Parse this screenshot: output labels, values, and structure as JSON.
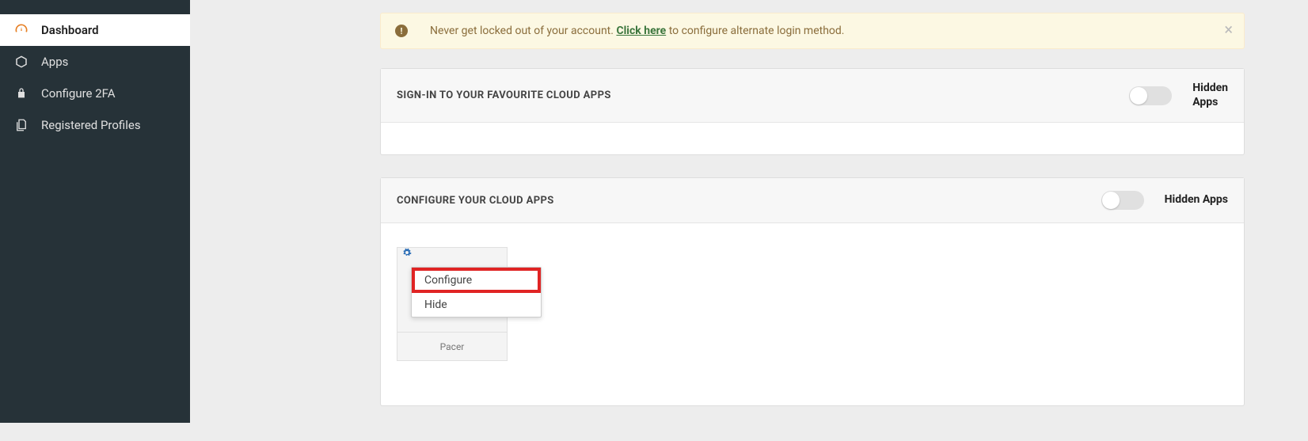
{
  "sidebar": {
    "items": [
      {
        "label": "Dashboard",
        "icon": "gauge-icon",
        "active": true
      },
      {
        "label": "Apps",
        "icon": "cube-icon",
        "active": false
      },
      {
        "label": "Configure 2FA",
        "icon": "lock-icon",
        "active": false
      },
      {
        "label": "Registered Profiles",
        "icon": "files-icon",
        "active": false
      }
    ]
  },
  "alert": {
    "text_before": "Never get locked out of your account. ",
    "link_text": "Click here",
    "text_after": " to configure alternate login method."
  },
  "panel_signin": {
    "title": "SIGN-IN TO YOUR FAVOURITE CLOUD APPS",
    "hidden_label_line1": "Hidden",
    "hidden_label_line2": "Apps"
  },
  "panel_configure": {
    "title": "CONFIGURE YOUR CLOUD APPS",
    "hidden_label": "Hidden Apps",
    "app": {
      "name": "Pacer",
      "menu": {
        "configure": "Configure",
        "hide": "Hide"
      }
    }
  }
}
